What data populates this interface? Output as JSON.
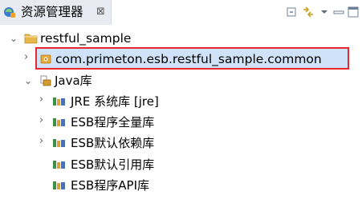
{
  "view": {
    "title": "资源管理器",
    "close_glyph": "⊠"
  },
  "tree": {
    "project": {
      "label": "restful_sample"
    },
    "package": {
      "label": "com.primeton.esb.restful_sample.common"
    },
    "library_group": {
      "label": "Java库"
    },
    "libraries": [
      {
        "label": "JRE 系统库 [jre]",
        "expandable": true
      },
      {
        "label": "ESB程序全量库",
        "expandable": true
      },
      {
        "label": "ESB默认依赖库",
        "expandable": true
      },
      {
        "label": "ESB默认引用库",
        "expandable": false
      },
      {
        "label": "ESB程序API库",
        "expandable": false
      }
    ]
  },
  "colors": {
    "selection_background": "#cfe2f7",
    "highlight_border": "#e8262f",
    "folder_yellow": "#e6b84a"
  },
  "icons": {
    "view": "explorer-view-icon",
    "toolbar": [
      "collapse-all-icon",
      "link-with-editor-icon",
      "view-menu-icon",
      "minimize-icon",
      "maximize-icon"
    ],
    "project": "project-folder-icon",
    "package": "package-icon",
    "library_group": "library-container-icon",
    "library": "jar-library-icon"
  }
}
